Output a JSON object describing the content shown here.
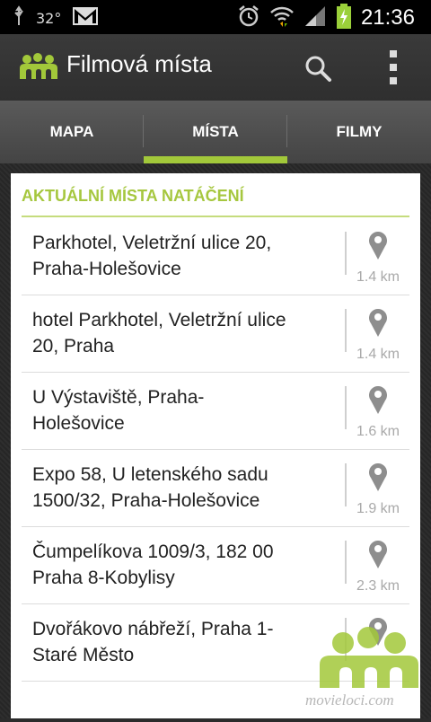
{
  "status_bar": {
    "temperature": "32°",
    "time": "21:36",
    "icons": [
      "usb-icon",
      "weather-icon",
      "gmail-icon",
      "alarm-icon",
      "wifi-icon",
      "signal-icon",
      "battery-charging-icon"
    ]
  },
  "action_bar": {
    "title": "Filmová místa",
    "logo_icon": "film-places-logo-icon",
    "search_icon": "search-icon",
    "menu_icon": "overflow-menu-icon"
  },
  "tabs": [
    {
      "label": "MAPA",
      "selected": false
    },
    {
      "label": "MÍSTA",
      "selected": true
    },
    {
      "label": "FILMY",
      "selected": false
    }
  ],
  "colors": {
    "accent": "#a2c83a",
    "header_text": "#a6c73f"
  },
  "list": {
    "header": "AKTUÁLNÍ MÍSTA NATÁČENÍ",
    "items": [
      {
        "line1": "Parkhotel, Veletržní ulice 20,",
        "line2": "Praha-Holešovice",
        "distance": "1.4 km"
      },
      {
        "line1": "hotel Parkhotel, Veletržní ulice",
        "line2": "20, Praha",
        "distance": "1.4 km"
      },
      {
        "line1": "U Výstaviště, Praha-",
        "line2": "Holešovice",
        "distance": "1.6 km"
      },
      {
        "line1": "Expo 58, U letenského sadu",
        "line2": "1500/32, Praha-Holešovice",
        "distance": "1.9 km"
      },
      {
        "line1": "Čumpelíkova 1009/3, 182 00",
        "line2": "Praha 8-Kobylisy",
        "distance": "2.3 km"
      },
      {
        "line1": "Dvořákovo nábřeží, Praha 1-",
        "line2": "Staré Město",
        "distance": ""
      }
    ]
  },
  "watermark": "movieloci.com"
}
